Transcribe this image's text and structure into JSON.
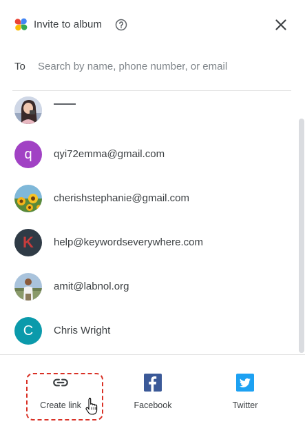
{
  "header": {
    "title": "Invite to album",
    "logo_icon": "google-photos-pinwheel-icon",
    "help_icon": "help-circle-icon",
    "close_icon": "close-icon"
  },
  "to_row": {
    "label": "To",
    "search_placeholder": "Search by name, phone number, or email",
    "search_value": ""
  },
  "contacts": [
    {
      "text": "",
      "avatar_type": "photo",
      "avatar_icon": "profile-photo-woman"
    },
    {
      "text": "qyi72emma@gmail.com",
      "avatar_type": "letter",
      "letter": "q",
      "color": "#a142c4"
    },
    {
      "text": "cherishstephanie@gmail.com",
      "avatar_type": "photo",
      "avatar_icon": "profile-photo-flowers"
    },
    {
      "text": "help@keywordseverywhere.com",
      "avatar_type": "letter",
      "letter": "K",
      "color": "#2f3b46",
      "letter_color": "#c63c3c"
    },
    {
      "text": "amit@labnol.org",
      "avatar_type": "photo",
      "avatar_icon": "profile-photo-man"
    },
    {
      "text": "Chris Wright",
      "avatar_type": "letter",
      "letter": "C",
      "color": "#0b9aab"
    }
  ],
  "share_options": [
    {
      "label": "Create link",
      "icon": "link-icon"
    },
    {
      "label": "Facebook",
      "icon": "facebook-icon",
      "color": "#3b5998"
    },
    {
      "label": "Twitter",
      "icon": "twitter-icon",
      "color": "#1da1f2"
    }
  ],
  "annotation": {
    "highlight_color": "#d93025",
    "cursor_icon": "hand-pointer-cursor-icon"
  }
}
